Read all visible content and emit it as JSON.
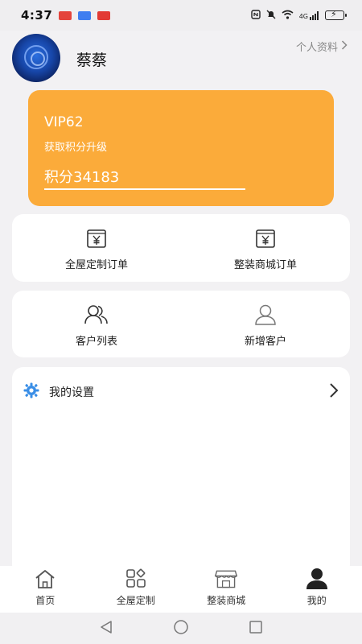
{
  "status_bar": {
    "time": "4:37",
    "network": "4G"
  },
  "profile": {
    "name": "蔡蔡",
    "link_label": "个人资料",
    "link_chevron": "›"
  },
  "vip": {
    "level": "VIP62",
    "hint": "获取积分升级",
    "points": "积分34183",
    "card_color": "#fbab3a"
  },
  "orders": [
    {
      "label": "全屋定制订单",
      "icon": "order-yen-icon"
    },
    {
      "label": "整装商城订单",
      "icon": "order-yen-icon"
    }
  ],
  "customers": [
    {
      "label": "客户列表",
      "icon": "users-icon"
    },
    {
      "label": "新增客户",
      "icon": "user-add-icon"
    }
  ],
  "settings": {
    "label": "我的设置",
    "icon": "gear-icon",
    "icon_color": "#3a8ee6"
  },
  "bottom_nav": [
    {
      "label": "首页",
      "icon": "home-icon"
    },
    {
      "label": "全屋定制",
      "icon": "grid-icon"
    },
    {
      "label": "整装商城",
      "icon": "store-icon"
    },
    {
      "label": "我的",
      "icon": "person-filled-icon",
      "active": true
    }
  ],
  "system_nav": [
    "back-icon",
    "home-circle-icon",
    "recents-icon"
  ]
}
